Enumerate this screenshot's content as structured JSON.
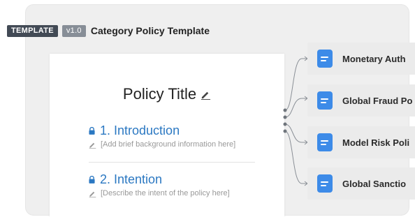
{
  "header": {
    "template_tag": "TEMPLATE",
    "version_tag": "v1.0",
    "title": "Category Policy Template"
  },
  "document": {
    "title": "Policy Title",
    "sections": [
      {
        "number_title": "1. Introduction",
        "placeholder": "[Add brief background information here]"
      },
      {
        "number_title": "2. Intention",
        "placeholder": "[Describe the intent of the policy here]"
      }
    ]
  },
  "linked_policies": [
    {
      "label": "Monetary Auth"
    },
    {
      "label": "Global Fraud Po"
    },
    {
      "label": "Model Risk Poli"
    },
    {
      "label": "Global Sanctio"
    }
  ],
  "colors": {
    "accent_blue": "#2b78c2",
    "doc_icon_blue": "#3d8be8",
    "tag_dark": "#424a55",
    "tag_gray": "#878e97"
  },
  "icons": {
    "edit": "pencil-icon",
    "lock": "lock-icon",
    "document": "document-icon"
  }
}
